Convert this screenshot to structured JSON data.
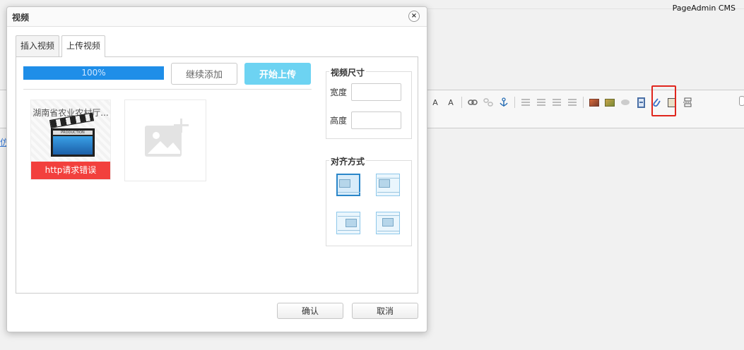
{
  "app": {
    "brand": "PageAdmin CMS"
  },
  "background": {
    "left_link": "仿"
  },
  "toolbar": {
    "icons": [
      "font-color-icon",
      "bg-color-icon",
      "link-icon",
      "unlink-icon",
      "anchor-icon",
      "align-left-icon",
      "align-center-icon",
      "align-right-icon",
      "align-justify-icon",
      "image-icon",
      "multi-image-icon",
      "map-icon",
      "video-icon",
      "attachment-icon",
      "template-icon",
      "pagebreak-icon"
    ],
    "font_color_label": "A",
    "bg_color_label": "A"
  },
  "dialog": {
    "title": "视频",
    "close_symbol": "×",
    "tabs": [
      {
        "label": "插入视频",
        "active": false
      },
      {
        "label": "上传视频",
        "active": true
      }
    ],
    "upload": {
      "progress_percent": 100,
      "progress_text": "100%",
      "continue_label": "继续添加",
      "start_label": "开始上传",
      "file": {
        "name": "湖南省农业农村厅...",
        "error": "http请求错误",
        "clapper_text": "PRODUCTION"
      }
    },
    "size": {
      "legend": "视频尺寸",
      "width_label": "宽度",
      "height_label": "高度",
      "width_value": "",
      "height_value": ""
    },
    "align": {
      "legend": "对齐方式",
      "options": [
        "none",
        "left",
        "right",
        "center"
      ],
      "selected": "none"
    },
    "confirm_label": "确认",
    "cancel_label": "取消"
  },
  "colors": {
    "progress": "#1f8ee8",
    "start_button": "#6dd3f2",
    "error": "#f2403d",
    "highlight": "#e0261d"
  }
}
